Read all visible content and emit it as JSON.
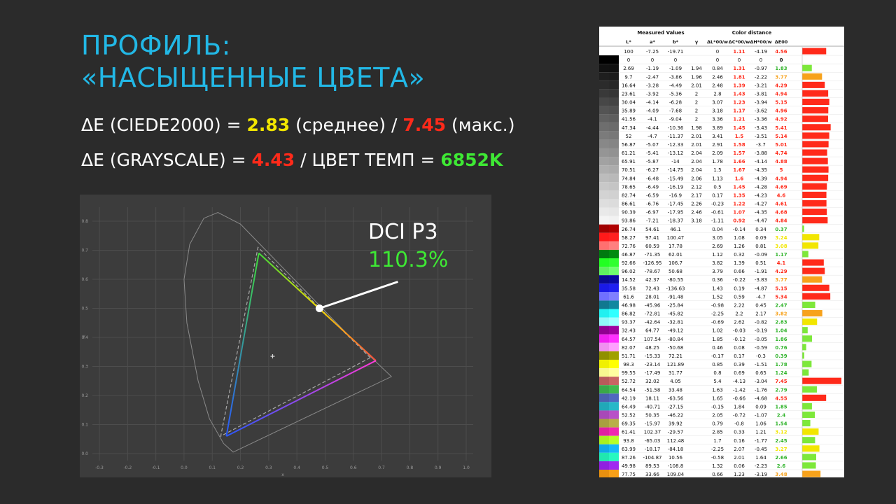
{
  "title": {
    "line1": "ПРОФИЛЬ:",
    "line2": "«НАСЫЩЕННЫЕ ЦВЕТА»"
  },
  "stats": {
    "line1": {
      "prefix": "ΔE (CIEDE2000) = ",
      "avg": "2.83",
      "mid": " (среднее) / ",
      "max": "7.45",
      "suffix": " (макс.)"
    },
    "line2": {
      "prefix": "ΔE (GRAYSCALE) = ",
      "gray": "4.43",
      "mid": " / ЦВЕТ ТЕМП = ",
      "temp": "6852K"
    }
  },
  "callout": {
    "label": "DCI P3",
    "value": "110.3%"
  },
  "colors": {
    "title": "#22b8e6",
    "green": "#3ee834",
    "yellow": "#f2e600",
    "red": "#ff2a1a",
    "orange": "#f7a21b",
    "gamut_bg": "#3c3c3c"
  },
  "chart_data": [
    {
      "type": "scatter",
      "title": "",
      "xlabel": "x",
      "ylabel": "y",
      "xlim": [
        -0.3,
        1.0
      ],
      "ylim": [
        0.0,
        0.8
      ],
      "x_ticks": [
        "-0.3",
        "-0.2",
        "-0.1",
        "0.0",
        "0.1",
        "0.2",
        "0.3",
        "0.4",
        "0.5",
        "0.6",
        "0.7",
        "0.8",
        "0.9",
        "1.0"
      ],
      "y_ticks": [
        "0.0",
        "0.1",
        "0.2",
        "0.3",
        "0.4",
        "0.5",
        "0.6",
        "0.7",
        "0.8"
      ],
      "grid": true,
      "spectral_locus": [
        [
          0.174,
          0.005
        ],
        [
          0.14,
          0.035
        ],
        [
          0.09,
          0.12
        ],
        [
          0.05,
          0.25
        ],
        [
          0.03,
          0.35
        ],
        [
          0.01,
          0.45
        ],
        [
          0.0,
          0.6
        ],
        [
          0.02,
          0.72
        ],
        [
          0.07,
          0.81
        ],
        [
          0.12,
          0.83
        ],
        [
          0.2,
          0.79
        ],
        [
          0.3,
          0.69
        ],
        [
          0.4,
          0.59
        ],
        [
          0.5,
          0.49
        ],
        [
          0.6,
          0.39
        ],
        [
          0.735,
          0.265
        ]
      ],
      "series": [
        {
          "name": "DCI P3",
          "points": [
            [
              0.68,
              0.32
            ],
            [
              0.265,
              0.69
            ],
            [
              0.15,
              0.06
            ]
          ]
        },
        {
          "points": [
            [
              0.66,
              0.33
            ],
            [
              0.262,
              0.71
            ],
            [
              0.13,
              0.06
            ]
          ]
        }
      ],
      "white_point": [
        0.314,
        0.335
      ],
      "highlight_point": [
        0.48,
        0.5
      ]
    },
    {
      "type": "table",
      "headers": {
        "group1": "Measured Values",
        "group2": "Color distance",
        "columns": [
          "L*",
          "a*",
          "b*",
          "γ",
          "ΔL*00/w",
          "ΔC*00/w",
          "ΔH*00/w",
          "ΔE00"
        ]
      },
      "dE_max": 7.45,
      "rows": [
        {
          "swatch": [
            "#ffffff",
            "#ffffff"
          ],
          "L": "100",
          "a": "-7.25",
          "b": "-19.71",
          "g": "",
          "dL": "0",
          "dC": "1.11",
          "dH": "-4.19",
          "dE": "4.56"
        },
        {
          "swatch": [
            "#000000",
            "#000000"
          ],
          "L": "0",
          "a": "0",
          "b": "0",
          "g": "",
          "dL": "0",
          "dC": "0",
          "dH": "0",
          "dE": "0"
        },
        {
          "swatch": [
            "#111111",
            "#101010"
          ],
          "L": "2.69",
          "a": "-1.19",
          "b": "-1.09",
          "g": "1.94",
          "dL": "0.84",
          "dC": "1.31",
          "dH": "-0.97",
          "dE": "1.83"
        },
        {
          "swatch": [
            "#1e1e1e",
            "#1c1c1c"
          ],
          "L": "9.7",
          "a": "-2.47",
          "b": "-3.86",
          "g": "1.96",
          "dL": "2.46",
          "dC": "1.81",
          "dH": "-2.22",
          "dE": "3.77"
        },
        {
          "swatch": [
            "#2b2b2b",
            "#282828"
          ],
          "L": "16.64",
          "a": "-3.28",
          "b": "-4.49",
          "g": "2.01",
          "dL": "2.48",
          "dC": "1.39",
          "dH": "-3.21",
          "dE": "4.29"
        },
        {
          "swatch": [
            "#393939",
            "#363636"
          ],
          "L": "23.61",
          "a": "-3.92",
          "b": "-5.36",
          "g": "2",
          "dL": "2.8",
          "dC": "1.43",
          "dH": "-3.81",
          "dE": "4.94"
        },
        {
          "swatch": [
            "#474747",
            "#444444"
          ],
          "L": "30.04",
          "a": "-4.14",
          "b": "-6.28",
          "g": "2",
          "dL": "3.07",
          "dC": "1.23",
          "dH": "-3.94",
          "dE": "5.15"
        },
        {
          "swatch": [
            "#545454",
            "#515151"
          ],
          "L": "35.89",
          "a": "-4.09",
          "b": "-7.68",
          "g": "2",
          "dL": "3.18",
          "dC": "1.17",
          "dH": "-3.62",
          "dE": "4.96"
        },
        {
          "swatch": [
            "#616161",
            "#5e5e5e"
          ],
          "L": "41.56",
          "a": "-4.1",
          "b": "-9.04",
          "g": "2",
          "dL": "3.36",
          "dC": "1.21",
          "dH": "-3.36",
          "dE": "4.92"
        },
        {
          "swatch": [
            "#6e6e6e",
            "#6b6b6b"
          ],
          "L": "47.34",
          "a": "-4.44",
          "b": "-10.36",
          "g": "1.98",
          "dL": "3.89",
          "dC": "1.45",
          "dH": "-3.43",
          "dE": "5.41"
        },
        {
          "swatch": [
            "#7b7b7b",
            "#787878"
          ],
          "L": "52",
          "a": "-4.7",
          "b": "-11.37",
          "g": "2.01",
          "dL": "3.41",
          "dC": "1.5",
          "dH": "-3.51",
          "dE": "5.14"
        },
        {
          "swatch": [
            "#888888",
            "#858585"
          ],
          "L": "56.87",
          "a": "-5.07",
          "b": "-12.33",
          "g": "2.01",
          "dL": "2.91",
          "dC": "1.58",
          "dH": "-3.7",
          "dE": "5.01"
        },
        {
          "swatch": [
            "#959595",
            "#929292"
          ],
          "L": "61.21",
          "a": "-5.41",
          "b": "-13.12",
          "g": "2.04",
          "dL": "2.09",
          "dC": "1.57",
          "dH": "-3.88",
          "dE": "4.74"
        },
        {
          "swatch": [
            "#a2a2a2",
            "#9f9f9f"
          ],
          "L": "65.91",
          "a": "-5.87",
          "b": "-14",
          "g": "2.04",
          "dL": "1.78",
          "dC": "1.66",
          "dH": "-4.14",
          "dE": "4.88"
        },
        {
          "swatch": [
            "#afafaf",
            "#acacac"
          ],
          "L": "70.51",
          "a": "-6.27",
          "b": "-14.75",
          "g": "2.04",
          "dL": "1.5",
          "dC": "1.67",
          "dH": "-4.35",
          "dE": "5"
        },
        {
          "swatch": [
            "#bcbcbc",
            "#b9b9b9"
          ],
          "L": "74.84",
          "a": "-6.48",
          "b": "-15.49",
          "g": "2.06",
          "dL": "1.13",
          "dC": "1.6",
          "dH": "-4.39",
          "dE": "4.94"
        },
        {
          "swatch": [
            "#c8c8c8",
            "#c5c5c5"
          ],
          "L": "78.65",
          "a": "-6.49",
          "b": "-16.19",
          "g": "2.12",
          "dL": "0.5",
          "dC": "1.45",
          "dH": "-4.28",
          "dE": "4.69"
        },
        {
          "swatch": [
            "#d3d3d3",
            "#d1d1d1"
          ],
          "L": "82.74",
          "a": "-6.59",
          "b": "-16.9",
          "g": "2.17",
          "dL": "0.17",
          "dC": "1.35",
          "dH": "-4.23",
          "dE": "4.6"
        },
        {
          "swatch": [
            "#dedede",
            "#dcdcdc"
          ],
          "L": "86.61",
          "a": "-6.76",
          "b": "-17.45",
          "g": "2.26",
          "dL": "-0.23",
          "dC": "1.22",
          "dH": "-4.27",
          "dE": "4.61"
        },
        {
          "swatch": [
            "#e9e9e9",
            "#e7e7e7"
          ],
          "L": "90.39",
          "a": "-6.97",
          "b": "-17.95",
          "g": "2.46",
          "dL": "-0.61",
          "dC": "1.07",
          "dH": "-4.35",
          "dE": "4.68"
        },
        {
          "swatch": [
            "#f4f4f4",
            "#f2f2f2"
          ],
          "L": "93.86",
          "a": "-7.21",
          "b": "-18.37",
          "g": "3.18",
          "dL": "-1.11",
          "dC": "0.92",
          "dH": "-4.47",
          "dE": "4.84"
        },
        {
          "swatch": [
            "#a00000",
            "#b00000"
          ],
          "L": "26.74",
          "a": "54.61",
          "b": "46.1",
          "g": "",
          "dL": "0.04",
          "dC": "-0.14",
          "dH": "0.34",
          "dE": "0.37"
        },
        {
          "swatch": [
            "#ff1a1a",
            "#ff2020"
          ],
          "L": "58.27",
          "a": "97.41",
          "b": "100.47",
          "g": "",
          "dL": "3.05",
          "dC": "1.08",
          "dH": "0.09",
          "dE": "3.24"
        },
        {
          "swatch": [
            "#ff7070",
            "#ff8080"
          ],
          "L": "72.76",
          "a": "60.59",
          "b": "17.78",
          "g": "",
          "dL": "2.69",
          "dC": "1.26",
          "dH": "0.81",
          "dE": "3.08"
        },
        {
          "swatch": [
            "#007a10",
            "#008a10"
          ],
          "L": "46.87",
          "a": "-71.35",
          "b": "62.01",
          "g": "",
          "dL": "1.12",
          "dC": "0.32",
          "dH": "-0.09",
          "dE": "1.17"
        },
        {
          "swatch": [
            "#22ff22",
            "#30ff30"
          ],
          "L": "92.66",
          "a": "-126.95",
          "b": "106.7",
          "g": "",
          "dL": "3.82",
          "dC": "1.39",
          "dH": "0.51",
          "dE": "4.1"
        },
        {
          "swatch": [
            "#60f060",
            "#70ff70"
          ],
          "L": "96.02",
          "a": "-78.67",
          "b": "50.68",
          "g": "",
          "dL": "3.79",
          "dC": "0.66",
          "dH": "-1.91",
          "dE": "4.29"
        },
        {
          "swatch": [
            "#0a0a90",
            "#0a0aa0"
          ],
          "L": "14.52",
          "a": "42.37",
          "b": "-80.55",
          "g": "",
          "dL": "0.36",
          "dC": "-0.22",
          "dH": "-3.83",
          "dE": "3.77"
        },
        {
          "swatch": [
            "#1a1ae8",
            "#2020f0"
          ],
          "L": "35.58",
          "a": "72.43",
          "b": "-136.63",
          "g": "",
          "dL": "1.43",
          "dC": "0.19",
          "dH": "-4.87",
          "dE": "5.15"
        },
        {
          "swatch": [
            "#7070ff",
            "#8080ff"
          ],
          "L": "61.6",
          "a": "28.01",
          "b": "-91.48",
          "g": "",
          "dL": "1.52",
          "dC": "0.59",
          "dH": "-4.7",
          "dE": "5.34"
        },
        {
          "swatch": [
            "#107890",
            "#1088a0"
          ],
          "L": "46.98",
          "a": "-45.96",
          "b": "-25.84",
          "g": "",
          "dL": "-0.98",
          "dC": "2.22",
          "dH": "0.45",
          "dE": "2.47"
        },
        {
          "swatch": [
            "#22f0f0",
            "#30ffff"
          ],
          "L": "86.82",
          "a": "-72.81",
          "b": "-45.82",
          "g": "",
          "dL": "-2.25",
          "dC": "2.2",
          "dH": "2.17",
          "dE": "3.82"
        },
        {
          "swatch": [
            "#90f8f8",
            "#a0ffff"
          ],
          "L": "93.37",
          "a": "-42.64",
          "b": "-32.81",
          "g": "",
          "dL": "-0.69",
          "dC": "2.62",
          "dH": "-0.82",
          "dE": "2.83"
        },
        {
          "swatch": [
            "#900090",
            "#a000a0"
          ],
          "L": "32.43",
          "a": "64.77",
          "b": "-49.12",
          "g": "",
          "dL": "1.02",
          "dC": "-0.03",
          "dH": "-0.19",
          "dE": "1.04"
        },
        {
          "swatch": [
            "#f020f0",
            "#ff30ff"
          ],
          "L": "64.57",
          "a": "107.54",
          "b": "-80.84",
          "g": "",
          "dL": "1.85",
          "dC": "-0.12",
          "dH": "-0.05",
          "dE": "1.86"
        },
        {
          "swatch": [
            "#f090f0",
            "#ffa0ff"
          ],
          "L": "82.07",
          "a": "48.25",
          "b": "-50.68",
          "g": "",
          "dL": "0.46",
          "dC": "0.08",
          "dH": "-0.59",
          "dE": "0.76"
        },
        {
          "swatch": [
            "#909000",
            "#a0a000"
          ],
          "L": "51.71",
          "a": "-15.33",
          "b": "72.21",
          "g": "",
          "dL": "-0.17",
          "dC": "0.17",
          "dH": "-0.3",
          "dE": "0.39"
        },
        {
          "swatch": [
            "#f0f000",
            "#ffff00"
          ],
          "L": "98.3",
          "a": "-23.14",
          "b": "121.89",
          "g": "",
          "dL": "0.85",
          "dC": "0.39",
          "dH": "-1.51",
          "dE": "1.78"
        },
        {
          "swatch": [
            "#f8f890",
            "#ffffa0"
          ],
          "L": "99.55",
          "a": "-17.49",
          "b": "31.77",
          "g": "",
          "dL": "0.8",
          "dC": "0.69",
          "dH": "0.65",
          "dE": "1.24"
        },
        {
          "swatch": [
            "#b85a5a",
            "#c86464"
          ],
          "L": "52.72",
          "a": "32.02",
          "b": "4.05",
          "g": "",
          "dL": "5.4",
          "dC": "-4.13",
          "dH": "-3.04",
          "dE": "7.45"
        },
        {
          "swatch": [
            "#3aa84a",
            "#40b850"
          ],
          "L": "64.54",
          "a": "-51.58",
          "b": "33.48",
          "g": "",
          "dL": "1.63",
          "dC": "-1.42",
          "dH": "-1.76",
          "dE": "2.79"
        },
        {
          "swatch": [
            "#4a60b0",
            "#5068c0"
          ],
          "L": "42.19",
          "a": "18.11",
          "b": "-63.56",
          "g": "",
          "dL": "1.65",
          "dC": "-0.66",
          "dH": "-4.68",
          "dE": "4.55"
        },
        {
          "swatch": [
            "#20a8b8",
            "#28b8c8"
          ],
          "L": "64.49",
          "a": "-40.71",
          "b": "-27.15",
          "g": "",
          "dL": "-0.15",
          "dC": "1.84",
          "dH": "0.09",
          "dE": "1.85"
        },
        {
          "swatch": [
            "#a848b8",
            "#b850c8"
          ],
          "L": "52.52",
          "a": "50.35",
          "b": "-46.22",
          "g": "",
          "dL": "2.05",
          "dC": "-0.72",
          "dH": "-1.07",
          "dE": "2.4"
        },
        {
          "swatch": [
            "#a8a040",
            "#b8b048"
          ],
          "L": "69.35",
          "a": "-15.97",
          "b": "39.92",
          "g": "",
          "dL": "0.79",
          "dC": "-0.8",
          "dH": "1.06",
          "dE": "1.54"
        },
        {
          "swatch": [
            "#e020a0",
            "#f028b0"
          ],
          "L": "61.41",
          "a": "102.37",
          "b": "-29.57",
          "g": "",
          "dL": "2.85",
          "dC": "0.33",
          "dH": "1.21",
          "dE": "3.12"
        },
        {
          "swatch": [
            "#a8f020",
            "#b8ff28"
          ],
          "L": "93.8",
          "a": "-65.03",
          "b": "112.48",
          "g": "",
          "dL": "1.7",
          "dC": "0.16",
          "dH": "-1.77",
          "dE": "2.45"
        },
        {
          "swatch": [
            "#10a8e8",
            "#18b8f8"
          ],
          "L": "63.99",
          "a": "-18.17",
          "b": "-84.18",
          "g": "",
          "dL": "-2.25",
          "dC": "2.07",
          "dH": "-0.45",
          "dE": "3.27"
        },
        {
          "swatch": [
            "#20e8b0",
            "#28f8c0"
          ],
          "L": "87.26",
          "a": "-104.87",
          "b": "10.56",
          "g": "",
          "dL": "-0.58",
          "dC": "2.01",
          "dH": "1.64",
          "dE": "2.66"
        },
        {
          "swatch": [
            "#9020e0",
            "#a028f0"
          ],
          "L": "49.98",
          "a": "89.53",
          "b": "-108.8",
          "g": "",
          "dL": "1.32",
          "dC": "0.06",
          "dH": "-2.23",
          "dE": "2.6"
        },
        {
          "swatch": [
            "#e89010",
            "#f8a018"
          ],
          "L": "77.75",
          "a": "33.66",
          "b": "109.04",
          "g": "",
          "dL": "0.66",
          "dC": "1.23",
          "dH": "-3.19",
          "dE": "3.48"
        }
      ]
    }
  ]
}
